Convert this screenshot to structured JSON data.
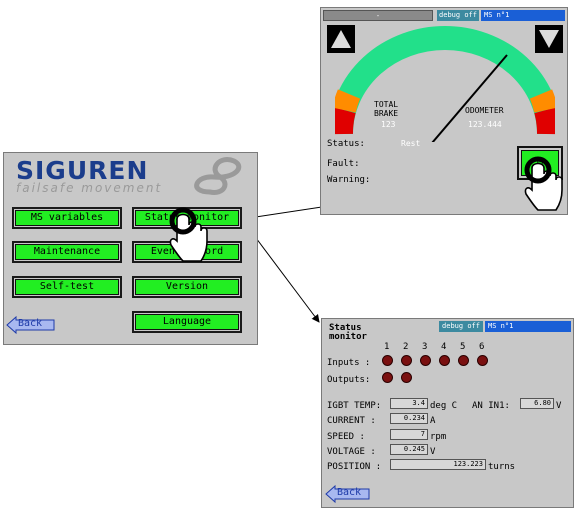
{
  "menu": {
    "logo_title": "SIGUREN",
    "logo_subtitle": "failsafe movement",
    "buttons": [
      "MS variables",
      "Status monitor",
      "Maintenance",
      "Event record",
      "Self-test",
      "Version",
      "Language"
    ],
    "back_label": "Back"
  },
  "gauge_screen": {
    "topbar": {
      "left_box": "-",
      "debug": "debug off",
      "ms": "MS n°1"
    },
    "total_label": "TOTAL",
    "brake_label": "BRAKE",
    "brake_value": "123",
    "odometer_label": "ODOMETER",
    "odometer_value": "123.444",
    "status_label": "Status:",
    "status_value": "Rest",
    "fault_label": "Fault:",
    "warning_label": "Warning:",
    "menu_button_label": "M"
  },
  "status_monitor": {
    "title_line1": "Status",
    "title_line2": "monitor",
    "topbar": {
      "debug": "debug off",
      "ms": "MS n°1"
    },
    "io_columns": [
      "1",
      "2",
      "3",
      "4",
      "5",
      "6"
    ],
    "inputs_label": "Inputs :",
    "outputs_label": "Outputs:",
    "inputs_state": [
      0,
      0,
      0,
      0,
      0,
      0
    ],
    "outputs_state": [
      0,
      0
    ],
    "readings": {
      "igbt_label": "IGBT TEMP:",
      "igbt_value": "3.4",
      "igbt_unit": "deg C",
      "anin_label": "AN IN1:",
      "anin_value": "6.80",
      "anin_unit": "V",
      "current_label": "CURRENT  :",
      "current_value": "0.234",
      "current_unit": "A",
      "speed_label": "SPEED    :",
      "speed_value": "7",
      "speed_unit": "rpm",
      "voltage_label": "VOLTAGE  :",
      "voltage_value": "0.245",
      "voltage_unit": "V",
      "position_label": "POSITION :",
      "position_value": "123.223",
      "position_unit": "turns"
    },
    "back_label": "Back"
  },
  "colors": {
    "button_green": "#22ee22",
    "panel_gray": "#c8c8c8",
    "logo_blue": "#1b3d8c",
    "led_red": "#7a1010",
    "topbar_blue": "#1a5fd6",
    "debug_teal": "#3c8aa0"
  }
}
